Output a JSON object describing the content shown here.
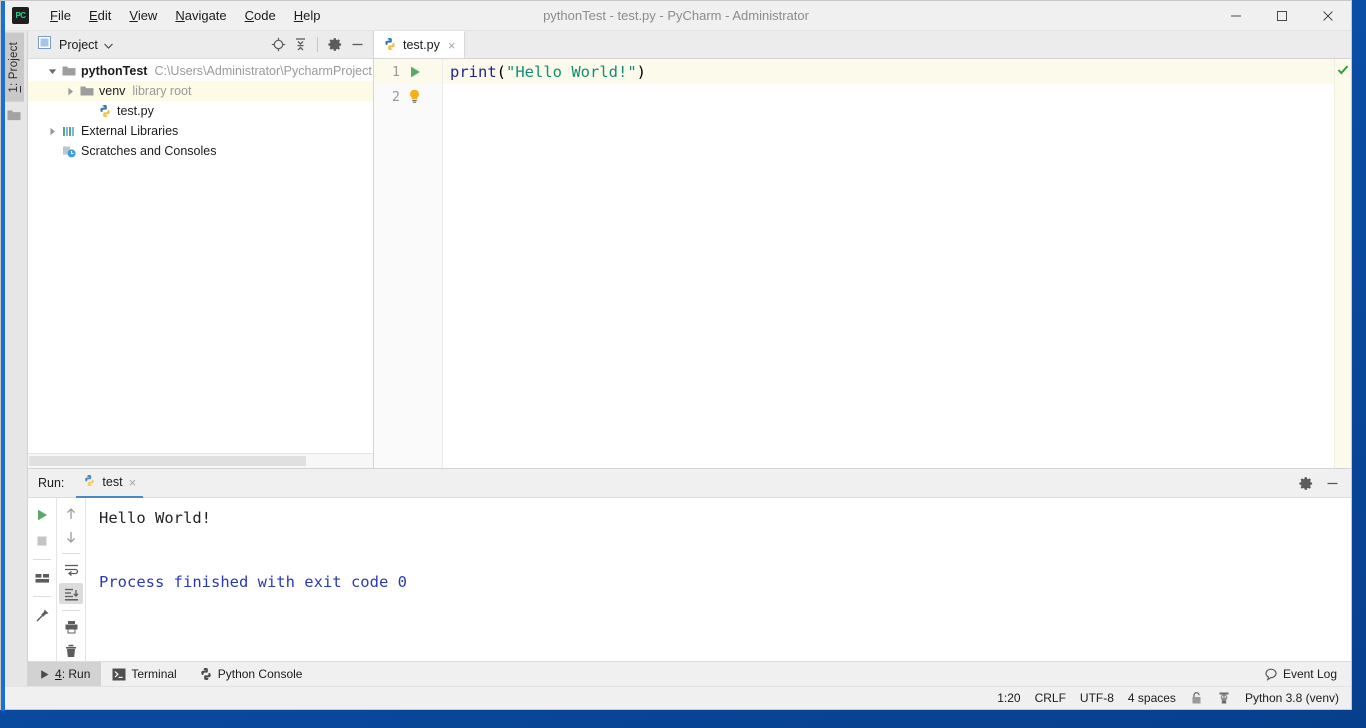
{
  "window": {
    "title": "pythonTest - test.py - PyCharm - Administrator",
    "logo_text": "PC",
    "minimize_label": "minimize",
    "maximize_label": "maximize",
    "close_label": "close"
  },
  "menubar": {
    "items": [
      {
        "pre": "",
        "mn": "F",
        "post": "ile",
        "name": "menu-file"
      },
      {
        "pre": "",
        "mn": "E",
        "post": "dit",
        "name": "menu-edit"
      },
      {
        "pre": "",
        "mn": "V",
        "post": "iew",
        "name": "menu-view"
      },
      {
        "pre": "",
        "mn": "N",
        "post": "avigate",
        "name": "menu-navigate"
      },
      {
        "pre": "",
        "mn": "C",
        "post": "ode",
        "name": "menu-code"
      },
      {
        "pre": "",
        "mn": "H",
        "post": "elp",
        "name": "menu-help"
      }
    ]
  },
  "toolwindow_bar": {
    "project_tab_mnemonic": "1",
    "project_tab_rest": ": Project"
  },
  "project_panel": {
    "title": "Project",
    "icons": [
      "locate-icon",
      "collapse-all-icon",
      "settings-icon",
      "hide-icon"
    ],
    "tree": [
      {
        "name": "pythonTest",
        "detail": "C:\\Users\\Administrator\\PycharmProject",
        "icon": "folder-icon",
        "expanded": true,
        "bold": true,
        "indent": 0,
        "selected": false,
        "has_arrow": true
      },
      {
        "name": "venv",
        "detail": "library root",
        "icon": "folder-icon",
        "expanded": false,
        "bold": false,
        "indent": 1,
        "selected": true,
        "has_arrow": true
      },
      {
        "name": "test.py",
        "detail": "",
        "icon": "python-file-icon",
        "expanded": false,
        "bold": false,
        "indent": 2,
        "selected": false,
        "has_arrow": false
      },
      {
        "name": "External Libraries",
        "detail": "",
        "icon": "library-icon",
        "expanded": false,
        "bold": false,
        "indent": 0,
        "selected": false,
        "has_arrow": true
      },
      {
        "name": "Scratches and Consoles",
        "detail": "",
        "icon": "scratches-icon",
        "expanded": false,
        "bold": false,
        "indent": 0,
        "selected": false,
        "has_arrow": false
      }
    ]
  },
  "editor": {
    "tabs": [
      {
        "label": "test.py",
        "icon": "python-file-icon",
        "active": true,
        "close": "×"
      }
    ],
    "lines": [
      {
        "number": "1",
        "active": true,
        "gutter_icon": "run-arrow-icon",
        "tokens": [
          {
            "text": "print",
            "cls": "t-fn"
          },
          {
            "text": "(",
            "cls": "t-punc"
          },
          {
            "text": "\"Hello World!\"",
            "cls": "t-str"
          },
          {
            "text": ")",
            "cls": "t-punc"
          }
        ]
      },
      {
        "number": "2",
        "active": false,
        "gutter_icon": "intention-bulb-icon",
        "tokens": []
      }
    ],
    "inspection_status": "ok-checkmark-icon"
  },
  "run_panel": {
    "label": "Run:",
    "tab": {
      "label": "test",
      "icon": "python-icon",
      "close": "×"
    },
    "header_icons": [
      "settings-icon",
      "hide-icon"
    ],
    "toolbar_left": [
      "rerun-icon",
      "stop-icon",
      "layout-icon",
      "pin-icon"
    ],
    "toolbar_right": [
      "up-icon",
      "down-icon",
      "soft-wrap-icon",
      "scroll-to-end-icon",
      "print-icon",
      "clear-all-icon"
    ],
    "console_lines": [
      {
        "text": "Hello World!",
        "type": "stdout"
      },
      {
        "text": "",
        "type": "blank"
      },
      {
        "text": "Process finished with exit code 0",
        "type": "info"
      }
    ]
  },
  "bottom_bar": {
    "buttons": [
      {
        "mn": "4",
        "rest": ": Run",
        "icon": "run-arrow-icon",
        "active": true,
        "name": "bottom-tab-run"
      },
      {
        "mn": "",
        "rest": "Terminal",
        "icon": "terminal-icon",
        "active": false,
        "name": "bottom-tab-terminal"
      },
      {
        "mn": "",
        "rest": "Python Console",
        "icon": "python-icon",
        "active": false,
        "name": "bottom-tab-python-console"
      }
    ],
    "event_log": {
      "label": "Event Log",
      "icon": "event-log-icon"
    }
  },
  "status_bar": {
    "caret": "1:20",
    "line_separator": "CRLF",
    "encoding": "UTF-8",
    "indent": "4 spaces",
    "lock_icon": "lock-icon",
    "hector_icon": "inspection-level-icon",
    "interpreter": "Python 3.8 (venv)"
  }
}
